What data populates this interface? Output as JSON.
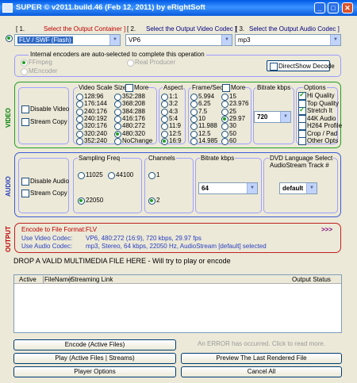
{
  "window": {
    "title": "SUPER © v2011.build.46 (Feb 12, 2011) by eRightSoft"
  },
  "header": {
    "container_step": "[ 1.",
    "container_text": "Select the Output Container ]",
    "video_step": "[ 2.",
    "video_text": "Select the Output Video Codec ]",
    "audio_step": "[ 3.",
    "audio_text": "Select the Output Audio Codec ]"
  },
  "selectors": {
    "container": "FLV / SWF (Flash)",
    "video_codec": "VP6",
    "audio_codec": "mp3"
  },
  "encoders": {
    "title": "Internal encoders are auto-selected to complete this operation",
    "ffmpeg": "FFmpeg",
    "mencoder": "MEncoder",
    "real": "Real Producer",
    "directshow": "DirectShow Decode"
  },
  "video": {
    "side_label": "VIDEO",
    "disable": "Disable Video",
    "stream_copy": "Stream Copy",
    "scale_title": "Video Scale Size",
    "scale_more": "More",
    "scale_col1": [
      "128:96",
      "176:144",
      "240:176",
      "240:192",
      "320:176",
      "320:240",
      "352:240"
    ],
    "scale_col2": [
      "352:288",
      "368:208",
      "384:288",
      "416:176",
      "480:272",
      "480:320",
      "NoChange"
    ],
    "aspect_title": "Aspect",
    "aspects": [
      "1:1",
      "3:2",
      "4:3",
      "5:4",
      "11:9",
      "12:5",
      "16:9"
    ],
    "fps_title": "Frame/Sec",
    "fps_more": "More",
    "fps_col1": [
      "5.994",
      "6.25",
      "7.5",
      "10",
      "11.988",
      "12.5",
      "14.985"
    ],
    "fps_col2": [
      "15",
      "23.976",
      "25",
      "29.97",
      "30",
      "50",
      "60"
    ],
    "bitrate_title": "Bitrate  kbps",
    "bitrate": "720",
    "options_title": "Options",
    "options": [
      "Hi Quality",
      "Top Quality",
      "Stretch It",
      "44K Audio",
      "H264 Profile",
      "Crop / Pad",
      "Other Opts"
    ]
  },
  "audio": {
    "side_label": "AUDIO",
    "disable": "Disable Audio",
    "stream_copy": "Stream Copy",
    "freq_title": "Sampling Freq",
    "freqs": [
      "11025",
      "44100",
      "22050"
    ],
    "channels_title": "Channels",
    "channels": [
      "1",
      "2"
    ],
    "bitrate_title": "Bitrate  kbps",
    "bitrate": "64",
    "dvd_title": "DVD Language Select",
    "dvd_sub": "AudioStream  Track #",
    "dvd_value": "default"
  },
  "output": {
    "side_label": "OUTPUT",
    "format_label": "Encode to File Format:",
    "format_value": "FLV",
    "arrows": ">>>",
    "video_label": "Use Video Codec:",
    "video_value": "VP6,  480:272 (16:9),  720 kbps,  29.97 fps",
    "audio_label": "Use Audio Codec:",
    "audio_value": "mp3,  Stereo,  64 kbps,  22050 Hz,  AudioStream [default] selected"
  },
  "drop_text": "DROP A VALID MULTIMEDIA FILE HERE - Will try to play or encode",
  "file_table": {
    "columns": [
      "Active",
      "FileName",
      "Streaming Link",
      "Output Status"
    ]
  },
  "buttons": {
    "encode": "Encode (Active Files)",
    "error": "An ERROR has occurred. Click to read more.",
    "play": "Play (Active Files | Streams)",
    "preview": "Preview The Last Rendered File",
    "player_options": "Player Options",
    "cancel": "Cancel All"
  },
  "colors": {
    "title_bar": "#0058e6",
    "video_frame": "#20a020",
    "audio_frame": "#3a5ad8",
    "output_frame": "#c02020",
    "selection": "#316ac5"
  }
}
